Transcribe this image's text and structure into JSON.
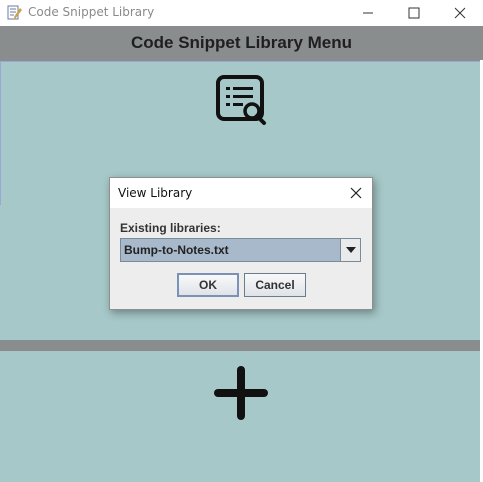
{
  "window": {
    "title": "Code Snippet Library"
  },
  "main": {
    "header": "Code Snippet Library Menu",
    "panels": [
      {
        "icon": "search-list-icon"
      },
      {
        "icon": "none"
      },
      {
        "icon": "plus-icon"
      }
    ]
  },
  "dialog": {
    "title": "View Library",
    "field_label": "Existing libraries:",
    "selected_library": "Bump-to-Notes.txt",
    "ok_label": "OK",
    "cancel_label": "Cancel"
  },
  "colors": {
    "panel_bg": "#a6c8c8",
    "header_bg": "#8a8d8e",
    "combo_bg": "#a9b9cc"
  }
}
